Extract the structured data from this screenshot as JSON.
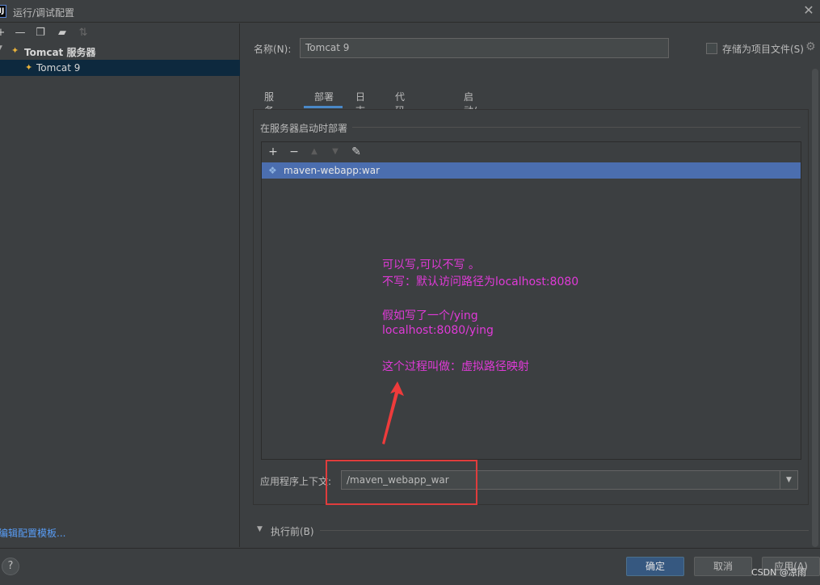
{
  "window": {
    "title": "运行/调试配置",
    "app_icon_label": "IJ"
  },
  "left": {
    "toolbar_icons": [
      "add-icon",
      "remove-icon",
      "copy-icon",
      "folder-icon",
      "sort-icon"
    ],
    "tree_group": "Tomcat 服务器",
    "tree_child": "Tomcat 9",
    "edit_templates": "编辑配置模板..."
  },
  "form": {
    "name_label": "名称(N):",
    "name_value": "Tomcat 9",
    "store_label": "存储为项目文件(S)"
  },
  "tabs": [
    "服务器",
    "部署",
    "日志",
    "代码覆盖率",
    "启动/连接"
  ],
  "active_tab": "部署",
  "deploy": {
    "section_title": "在服务器启动时部署",
    "artifact": "maven-webapp:war",
    "context_label": "应用程序上下文:",
    "context_value": "/maven_webapp_war"
  },
  "annotation": {
    "line1": "可以写,可以不写 。",
    "line2": "不写：默认访问路径为localhost:8080",
    "line3": "假如写了一个/ying",
    "line4": "localhost:8080/ying",
    "line5": "这个过程叫做：虚拟路径映射",
    "color": "#e03ad8"
  },
  "before_launch": "执行前(B)",
  "buttons": {
    "ok": "确定",
    "cancel": "取消",
    "apply": "应用(A)",
    "help": "?"
  },
  "watermark": "CSDN @凉雨"
}
